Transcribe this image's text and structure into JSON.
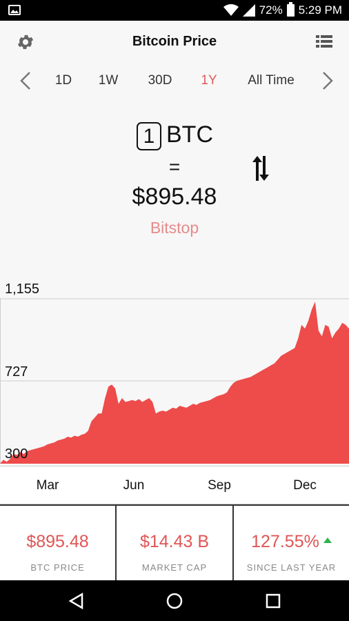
{
  "status_bar": {
    "battery": "72%",
    "time": "5:29 PM"
  },
  "app_bar": {
    "title": "Bitcoin Price"
  },
  "period_tabs": {
    "tabs": [
      "1D",
      "1W",
      "30D",
      "1Y",
      "All Time"
    ],
    "active": "1Y"
  },
  "converter": {
    "amount": "1",
    "currency": "BTC",
    "equals": "=",
    "price": "$895.48",
    "exchange": "Bitstop"
  },
  "chart_data": {
    "type": "area",
    "y_ticks": [
      "1,155",
      "727",
      "300"
    ],
    "x_labels": [
      "Mar",
      "Jun",
      "Sep",
      "Dec"
    ],
    "ylim": [
      300,
      1155
    ],
    "color": "#ee4b4b",
    "series": [
      {
        "values": [
          300,
          320,
          310,
          325,
          350,
          345,
          360,
          350,
          365,
          370,
          375,
          380,
          385,
          390,
          400,
          405,
          410,
          420,
          425,
          430,
          440,
          435,
          445,
          440,
          450,
          455,
          470,
          520,
          540,
          560,
          560,
          640,
          700,
          710,
          690,
          610,
          640,
          620,
          625,
          630,
          625,
          635,
          620,
          630,
          640,
          620,
          560,
          570,
          575,
          570,
          580,
          590,
          585,
          600,
          595,
          590,
          600,
          610,
          605,
          615,
          620,
          625,
          630,
          640,
          650,
          655,
          660,
          670,
          700,
          720,
          730,
          735,
          740,
          745,
          750,
          760,
          770,
          780,
          790,
          800,
          810,
          820,
          840,
          860,
          870,
          880,
          890,
          900,
          950,
          1020,
          1000,
          1040,
          1100,
          1140,
          990,
          960,
          1020,
          1010,
          950,
          980,
          1000,
          1030,
          1020,
          1000
        ]
      }
    ]
  },
  "months": [
    "Mar",
    "Jun",
    "Sep",
    "Dec"
  ],
  "stats": [
    {
      "value": "$895.48",
      "label": "BTC PRICE"
    },
    {
      "value": "$14.43 B",
      "label": "MARKET CAP"
    },
    {
      "value": "127.55%",
      "label": "SINCE LAST YEAR",
      "trend": "up"
    }
  ]
}
